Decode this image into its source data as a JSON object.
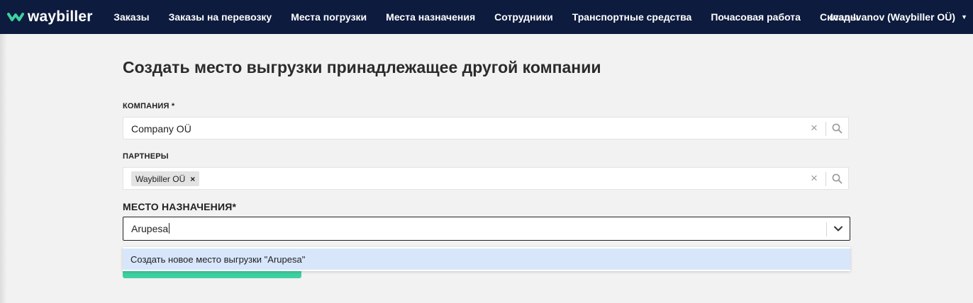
{
  "app": {
    "logo_text": "waybiller",
    "brand_color": "#3ecfa0",
    "nav_bg": "#0d1b3e"
  },
  "nav": {
    "items": [
      "Заказы",
      "Заказы на перевозку",
      "Места погрузки",
      "Места назначения",
      "Сотрудники",
      "Транспортные средства",
      "Почасовая работа",
      "Склады"
    ],
    "user": "Ivan Ivanov (Waybiller OÜ)"
  },
  "page": {
    "title": "Создать место выгрузки принадлежащее другой компании"
  },
  "form": {
    "company": {
      "label": "КОМПАНИЯ",
      "required_mark": "*",
      "value": "Company OÜ"
    },
    "partners": {
      "label": "ПАРТНЕРЫ",
      "tags": [
        "Waybiller OÜ"
      ]
    },
    "destination": {
      "label": "МЕСТО НАЗНАЧЕНИЯ*",
      "value": "Arupesa"
    },
    "dropdown": {
      "option": "Создать новое место выгрузки \"Arupesa\""
    }
  },
  "icons": {
    "clear": "close-icon",
    "search": "search-icon",
    "chevron": "chevron-down-icon",
    "user_caret": "caret-down-icon"
  }
}
